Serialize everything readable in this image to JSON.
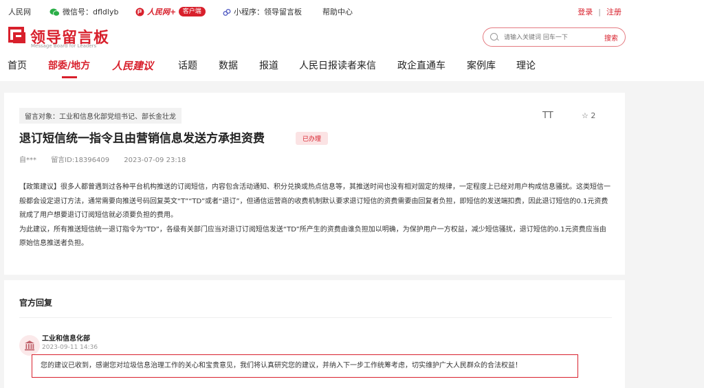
{
  "topbar": {
    "site": "人民网",
    "wechat": "微信号：dfldlyb",
    "client_logo": "人民网+",
    "client_badge": "客户端",
    "miniprogram": "小程序：领导留言板",
    "help": "帮助中心",
    "login": "登录",
    "separator": "|",
    "register": "注册"
  },
  "logo": {
    "title": "领导留言板",
    "subtitle": "Message Board for Leaders"
  },
  "search": {
    "placeholder": "请输入关键词 回车一下",
    "button": "搜索"
  },
  "nav": [
    "首页",
    "部委/地方",
    "人民建议",
    "话题",
    "数据",
    "报道",
    "人民日报读者来信",
    "政企直通车",
    "案例库",
    "理论"
  ],
  "message": {
    "target": "留言对象：工业和信息化部党组书记、部长金壮龙",
    "font_toggle": "TT",
    "star_count": "2",
    "title": "退订短信统一指令且由营销信息发送方承担资费",
    "status": "已办理",
    "author": "自***",
    "id": "留言ID:18396409",
    "time": "2023-07-09 23:18",
    "paragraphs": [
      "【政策建议】很多人都曾遇到过各种平台机构推送的订阅短信，内容包含活动通知、积分兑换或热点信息等，其推送时间也没有相对固定的规律，一定程度上已经对用户构成信息骚扰。这类短信一般都会设定退订方法，通常需要向推送号码回复英文“T”“TD”或者“退订”，但通信运营商的收费机制默认要求退订短信的资费需要由回复者负担，即短信的发送端扣费，因此退订短信的0.1元资费就成了用户想要退订订阅短信就必须要负担的费用。",
      "为此建议，所有推送短信统一退订指令为“TD”，各级有关部门应当对退订订阅短信发送“TD”所产生的资费由谁负担加以明确，为保护用户一方权益，减少短信骚扰，退订短信的0.1元资费应当由原始信息推送者负担。"
    ]
  },
  "reply": {
    "heading": "官方回复",
    "department": "工业和信息化部",
    "time": "2023-09-11 14:36",
    "content": "您的建议已收到，感谢您对垃圾信息治理工作的关心和宝贵意见，我们将认真研究您的建议，并纳入下一步工作统筹考虑，切实维护广大人民群众的合法权益！"
  },
  "colors": {
    "brand": "#d8202c",
    "background": "#f4f4f4"
  }
}
